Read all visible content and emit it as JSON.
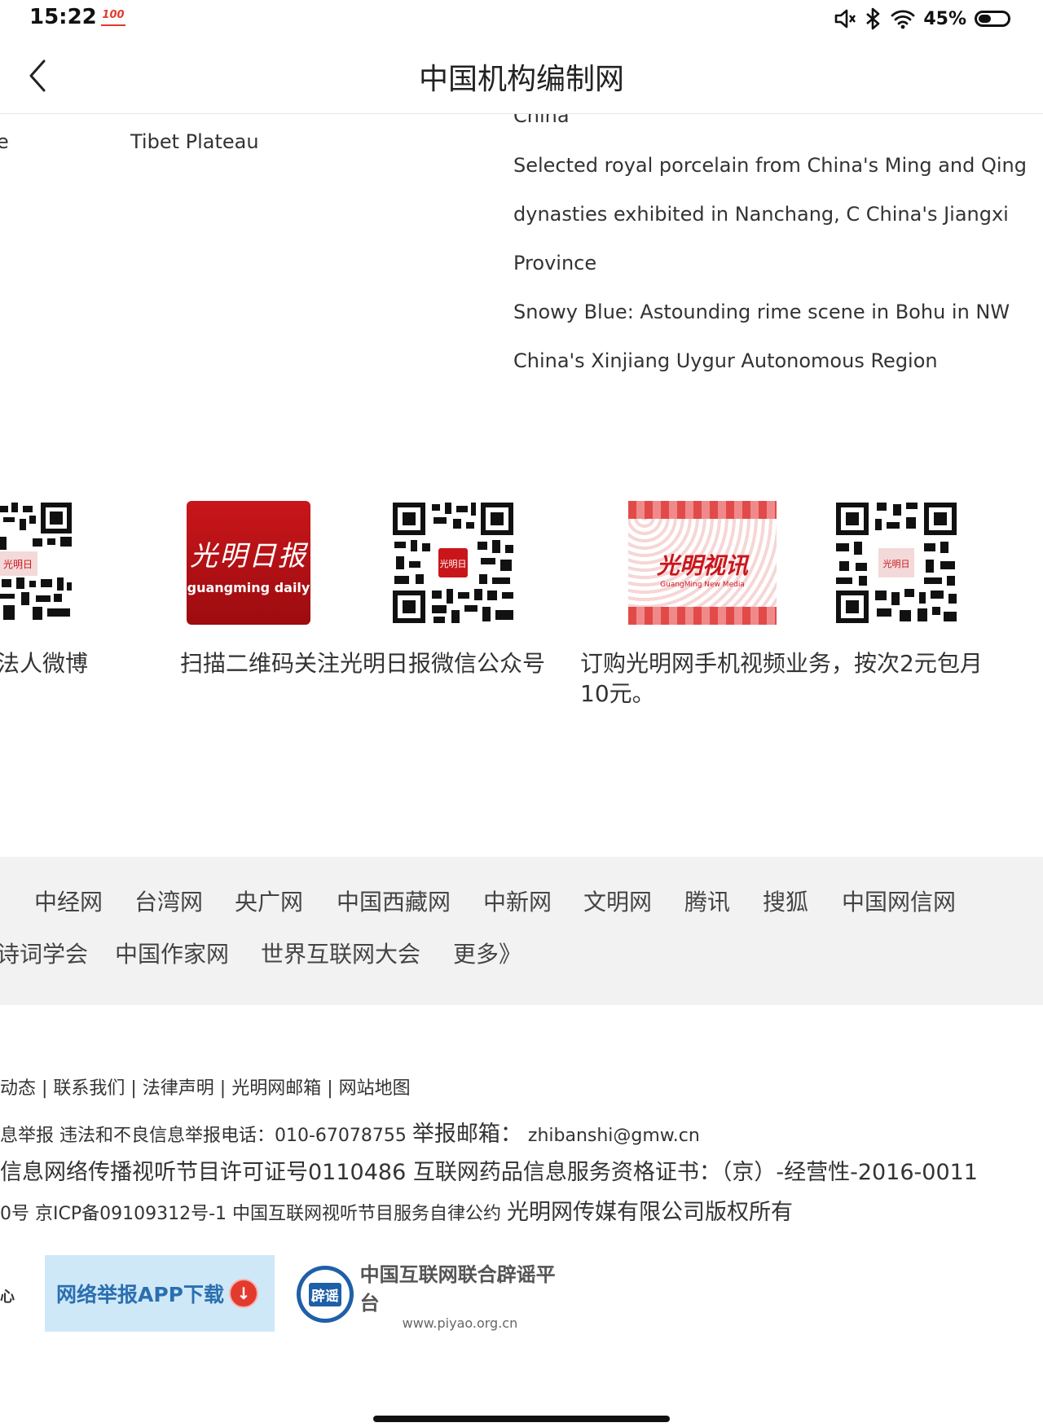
{
  "status_bar": {
    "time": "15:22",
    "badge": "100",
    "battery": "45%",
    "battery_level": 0.45
  },
  "header": {
    "title": "中国机构编制网"
  },
  "news": {
    "left_fragment": "e",
    "mid": "Tibet Plateau",
    "items": [
      "China",
      "Selected royal porcelain from China's Ming and Qing",
      "dynasties exhibited in Nanchang, C China's Jiangxi",
      "Province",
      "Snowy Blue: Astounding rime scene in Bohu in NW",
      "China's Xinjiang Uygur Autonomous Region"
    ]
  },
  "promo": {
    "gm_logo_cn": "光明日报",
    "gm_logo_en": "guangming daily",
    "gm_media_cn": "光明视讯",
    "gm_media_en": "GuangMing New Media",
    "caption_left": "法人微博",
    "caption_mid": "扫描二维码关注光明日报微信公众号",
    "caption_right_1": "订购光明网手机视频业务，按次2元包月",
    "caption_right_2": "10元。"
  },
  "links": {
    "row1": [
      "中经网",
      "台湾网",
      "央广网",
      "中国西藏网",
      "中新网",
      "文明网",
      "腾讯",
      "搜狐",
      "中国网信网"
    ],
    "row2": [
      "诗词学会",
      "中国作家网",
      "世界互联网大会",
      "更多》"
    ]
  },
  "footer": {
    "line1": "动态 | 联系我们 | 法律声明 | 光明网邮箱 | 网站地图",
    "line2a": "息举报 违法和不良信息举报电话：010-67078755 ",
    "line2b": "举报邮箱：",
    "line2c": " zhibanshi@gmw.cn",
    "line3": "信息网络传播视听节目许可证号0110486 互联网药品信息服务资格证书：（京）-经营性-2016-0011",
    "line4a": "0号 京ICP备09109312号-1 中国互联网视听节目服务自律公约 ",
    "line4b": "光明网传媒有限公司版权所有",
    "edge_icon_text": "心",
    "report_btn": "网络举报APP下载",
    "piyao_badge": "辟谣",
    "piyao_title": "中国互联网联合辟谣平台",
    "piyao_url": "www.piyao.org.cn"
  }
}
